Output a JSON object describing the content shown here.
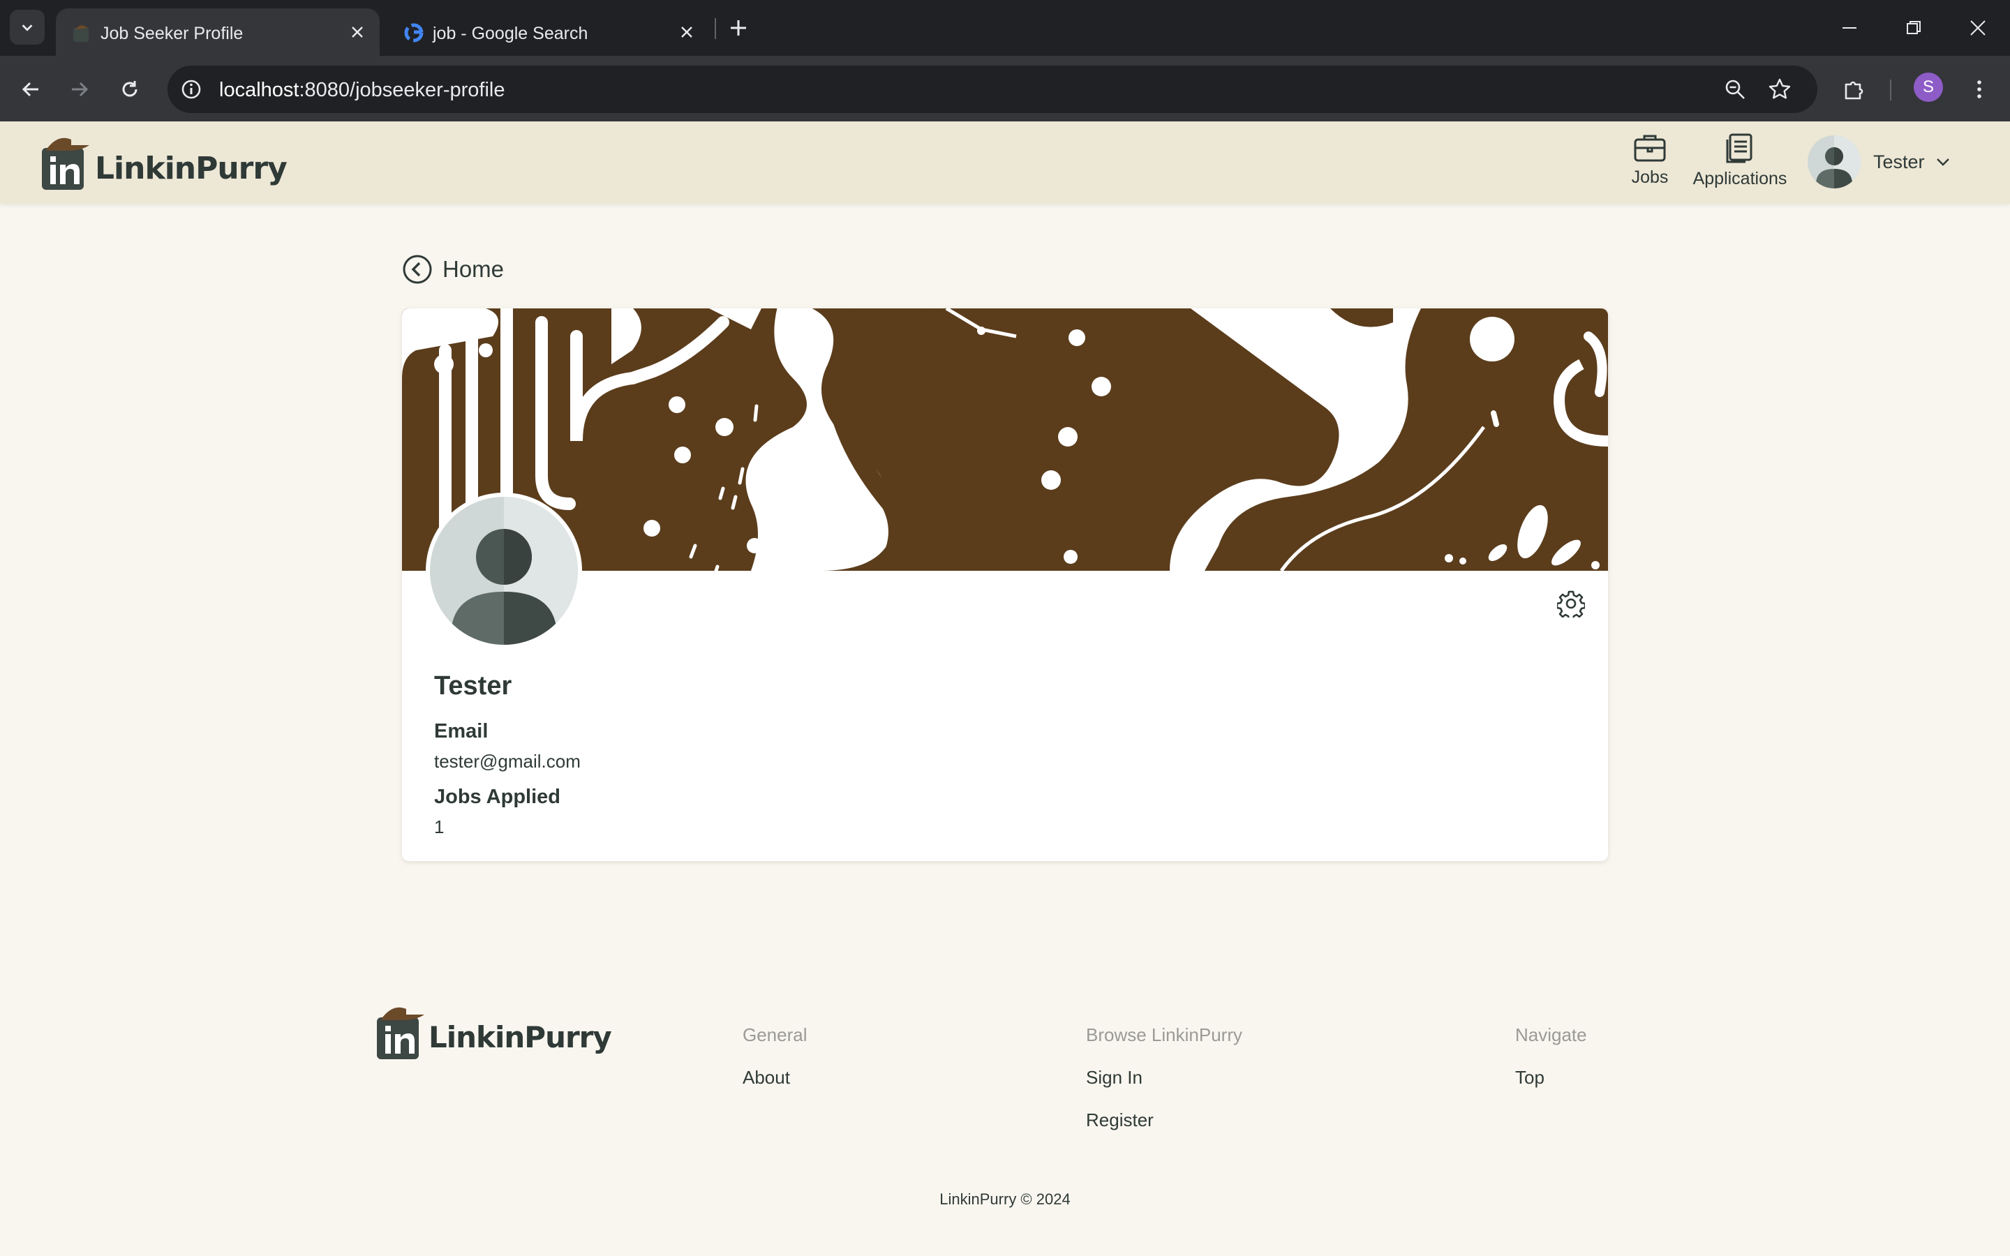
{
  "browser": {
    "tabs": [
      {
        "title": "Job Seeker Profile",
        "active": true
      },
      {
        "title": "job - Google Search",
        "active": false
      }
    ],
    "url_host": "localhost",
    "url_path": ":8080/jobseeker-profile",
    "profile_initial": "S"
  },
  "header": {
    "brand": "LinkinPurry",
    "nav": [
      {
        "label": "Jobs",
        "icon": "briefcase-icon"
      },
      {
        "label": "Applications",
        "icon": "documents-icon"
      }
    ],
    "user_name": "Tester"
  },
  "main": {
    "back_label": "Home",
    "profile": {
      "name": "Tester",
      "email_label": "Email",
      "email": "tester@gmail.com",
      "jobs_applied_label": "Jobs Applied",
      "jobs_applied": "1"
    }
  },
  "footer": {
    "brand": "LinkinPurry",
    "columns": [
      {
        "heading": "General",
        "links": [
          "About"
        ]
      },
      {
        "heading": "Browse LinkinPurry",
        "links": [
          "Sign In",
          "Register"
        ]
      },
      {
        "heading": "Navigate",
        "links": [
          "Top"
        ]
      }
    ],
    "copyright": "LinkinPurry © 2024"
  },
  "colors": {
    "page_bg": "#f9f6ef",
    "header_bg": "#ede7d6",
    "brand_brown": "#5b3d1c",
    "text_dark": "#2f3a37"
  }
}
